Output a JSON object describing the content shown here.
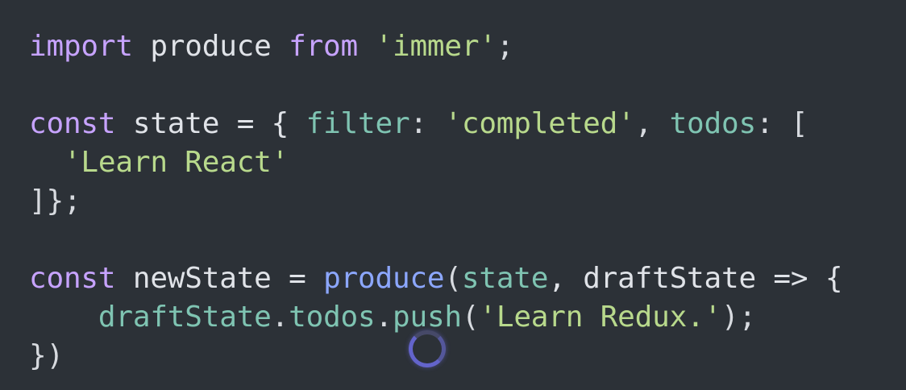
{
  "code": {
    "line1": {
      "kw_import": "import",
      "id_produce": " produce ",
      "kw_from": "from",
      "sp": " ",
      "str_immer": "'immer'",
      "semi": ";"
    },
    "line3": {
      "kw_const": "const",
      "id_state": " state = { ",
      "prop_filter": "filter",
      "colon1": ": ",
      "str_completed": "'completed'",
      "comma": ", ",
      "prop_todos": "todos",
      "tail": ": ["
    },
    "line4": {
      "indent": "  ",
      "str_learn_react": "'Learn React'"
    },
    "line5": {
      "close": "]};"
    },
    "line7": {
      "kw_const": "const",
      "id_newstate": " newState = ",
      "fn_produce": "produce",
      "paren": "(",
      "prop_state": "state",
      "tail": ", draftState => {"
    },
    "line8": {
      "indent": "    ",
      "prop_draftstate": "draftState",
      "dot1": ".",
      "prop_todos": "todos",
      "dot2": ".",
      "prop_push": "push",
      "paren_open": "(",
      "str_learn_redux": "'Learn Redux.'",
      "paren_close": ");"
    },
    "line9": {
      "close": "})"
    }
  },
  "colors": {
    "background": "#2c3137",
    "keyword": "#c7a3ff",
    "string": "#b8d98c",
    "property": "#7fc4b2",
    "function": "#8ca7ff",
    "text": "#d7dadf"
  },
  "spinner_icon": "loading-spinner-icon"
}
